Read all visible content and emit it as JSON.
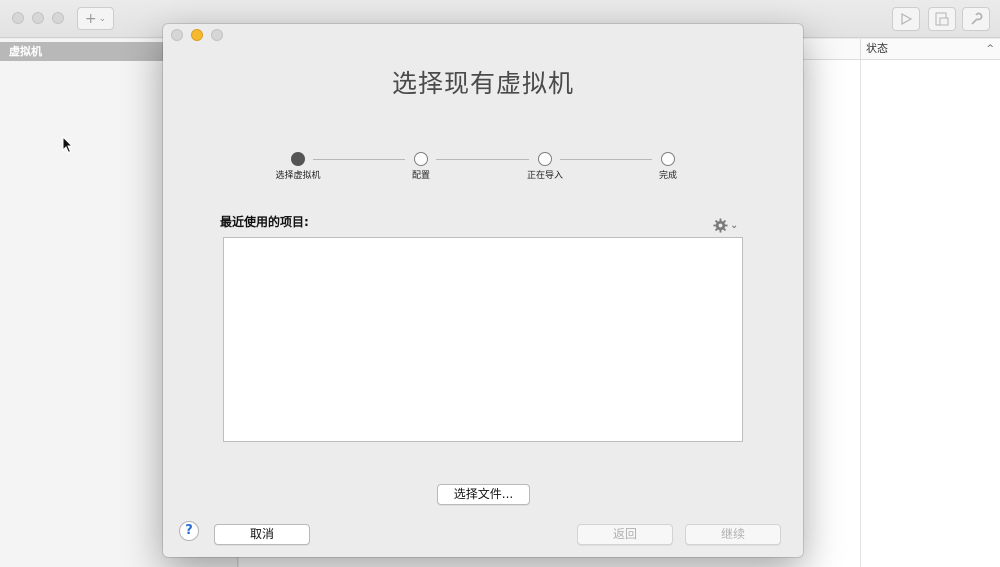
{
  "toolbar": {
    "add_icon": "plus-chevron-icon",
    "run_icon": "play-icon",
    "snapshot_icon": "snapshot-icon",
    "settings_icon": "wrench-icon"
  },
  "sidebar": {
    "header": "虚拟机"
  },
  "table": {
    "status_header": "状态"
  },
  "dialog": {
    "title": "选择现有虚拟机",
    "steps": [
      {
        "label": "选择虚拟机",
        "active": true
      },
      {
        "label": "配置",
        "active": false
      },
      {
        "label": "正在导入",
        "active": false
      },
      {
        "label": "完成",
        "active": false
      }
    ],
    "recent_label": "最近使用的项目:",
    "choose_file_button": "选择文件...",
    "help_button": "?",
    "cancel_button": "取消",
    "back_button": "返回",
    "continue_button": "继续",
    "colors": {
      "close": "#d6d6d6",
      "minimize": "#f5b92e",
      "zoom": "#d6d6d6",
      "active_step": "#555555"
    }
  }
}
